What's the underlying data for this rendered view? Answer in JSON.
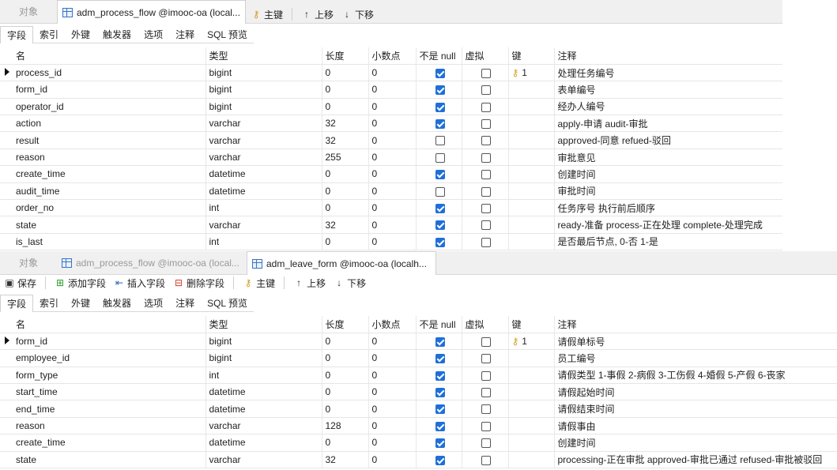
{
  "panel1": {
    "tabs": [
      {
        "label": "对象"
      },
      {
        "label": "adm_process_flow @imooc-oa (local..."
      }
    ],
    "toolbar": {
      "primary_key": "主键",
      "move_up": "上移",
      "move_down": "下移"
    },
    "prop_tabs": [
      "字段",
      "索引",
      "外键",
      "触发器",
      "选项",
      "注释",
      "SQL 预览"
    ],
    "columns": [
      "名",
      "类型",
      "长度",
      "小数点",
      "不是 null",
      "虚拟",
      "键",
      "注释"
    ],
    "rows": [
      {
        "name": "process_id",
        "type": "bigint",
        "length": "0",
        "decimals": "0",
        "not_null": true,
        "virtual": false,
        "key": "1",
        "comment": "处理任务编号"
      },
      {
        "name": "form_id",
        "type": "bigint",
        "length": "0",
        "decimals": "0",
        "not_null": true,
        "virtual": false,
        "key": "",
        "comment": "表单编号"
      },
      {
        "name": "operator_id",
        "type": "bigint",
        "length": "0",
        "decimals": "0",
        "not_null": true,
        "virtual": false,
        "key": "",
        "comment": "经办人编号"
      },
      {
        "name": "action",
        "type": "varchar",
        "length": "32",
        "decimals": "0",
        "not_null": true,
        "virtual": false,
        "key": "",
        "comment": "apply-申请 audit-审批"
      },
      {
        "name": "result",
        "type": "varchar",
        "length": "32",
        "decimals": "0",
        "not_null": false,
        "virtual": false,
        "key": "",
        "comment": "approved-同意 refued-驳回"
      },
      {
        "name": "reason",
        "type": "varchar",
        "length": "255",
        "decimals": "0",
        "not_null": false,
        "virtual": false,
        "key": "",
        "comment": "审批意见"
      },
      {
        "name": "create_time",
        "type": "datetime",
        "length": "0",
        "decimals": "0",
        "not_null": true,
        "virtual": false,
        "key": "",
        "comment": "创建时间"
      },
      {
        "name": "audit_time",
        "type": "datetime",
        "length": "0",
        "decimals": "0",
        "not_null": false,
        "virtual": false,
        "key": "",
        "comment": "审批时间"
      },
      {
        "name": "order_no",
        "type": "int",
        "length": "0",
        "decimals": "0",
        "not_null": true,
        "virtual": false,
        "key": "",
        "comment": "任务序号 执行前后顺序"
      },
      {
        "name": "state",
        "type": "varchar",
        "length": "32",
        "decimals": "0",
        "not_null": true,
        "virtual": false,
        "key": "",
        "comment": "ready-准备 process-正在处理 complete-处理完成"
      },
      {
        "name": "is_last",
        "type": "int",
        "length": "0",
        "decimals": "0",
        "not_null": true,
        "virtual": false,
        "key": "",
        "comment": "是否最后节点, 0-否 1-是"
      }
    ]
  },
  "panel2": {
    "tabs": [
      {
        "label": "对象"
      },
      {
        "label": "adm_process_flow @imooc-oa (local..."
      },
      {
        "label": "adm_leave_form @imooc-oa (localh..."
      }
    ],
    "toolbar": {
      "save": "保存",
      "add_field": "添加字段",
      "insert_field": "插入字段",
      "delete_field": "删除字段",
      "primary_key": "主键",
      "move_up": "上移",
      "move_down": "下移"
    },
    "prop_tabs": [
      "字段",
      "索引",
      "外键",
      "触发器",
      "选项",
      "注释",
      "SQL 预览"
    ],
    "columns": [
      "名",
      "类型",
      "长度",
      "小数点",
      "不是 null",
      "虚拟",
      "键",
      "注释"
    ],
    "rows": [
      {
        "name": "form_id",
        "type": "bigint",
        "length": "0",
        "decimals": "0",
        "not_null": true,
        "virtual": false,
        "key": "1",
        "comment": "请假单标号"
      },
      {
        "name": "employee_id",
        "type": "bigint",
        "length": "0",
        "decimals": "0",
        "not_null": true,
        "virtual": false,
        "key": "",
        "comment": "员工编号"
      },
      {
        "name": "form_type",
        "type": "int",
        "length": "0",
        "decimals": "0",
        "not_null": true,
        "virtual": false,
        "key": "",
        "comment": "请假类型 1-事假 2-病假 3-工伤假 4-婚假 5-产假 6-丧家"
      },
      {
        "name": "start_time",
        "type": "datetime",
        "length": "0",
        "decimals": "0",
        "not_null": true,
        "virtual": false,
        "key": "",
        "comment": "请假起始时间"
      },
      {
        "name": "end_time",
        "type": "datetime",
        "length": "0",
        "decimals": "0",
        "not_null": true,
        "virtual": false,
        "key": "",
        "comment": "请假结束时间"
      },
      {
        "name": "reason",
        "type": "varchar",
        "length": "128",
        "decimals": "0",
        "not_null": true,
        "virtual": false,
        "key": "",
        "comment": "请假事由"
      },
      {
        "name": "create_time",
        "type": "datetime",
        "length": "0",
        "decimals": "0",
        "not_null": true,
        "virtual": false,
        "key": "",
        "comment": "创建时间"
      },
      {
        "name": "state",
        "type": "varchar",
        "length": "32",
        "decimals": "0",
        "not_null": true,
        "virtual": false,
        "key": "",
        "comment": "processing-正在审批 approved-审批已通过 refused-审批被驳回"
      }
    ]
  }
}
